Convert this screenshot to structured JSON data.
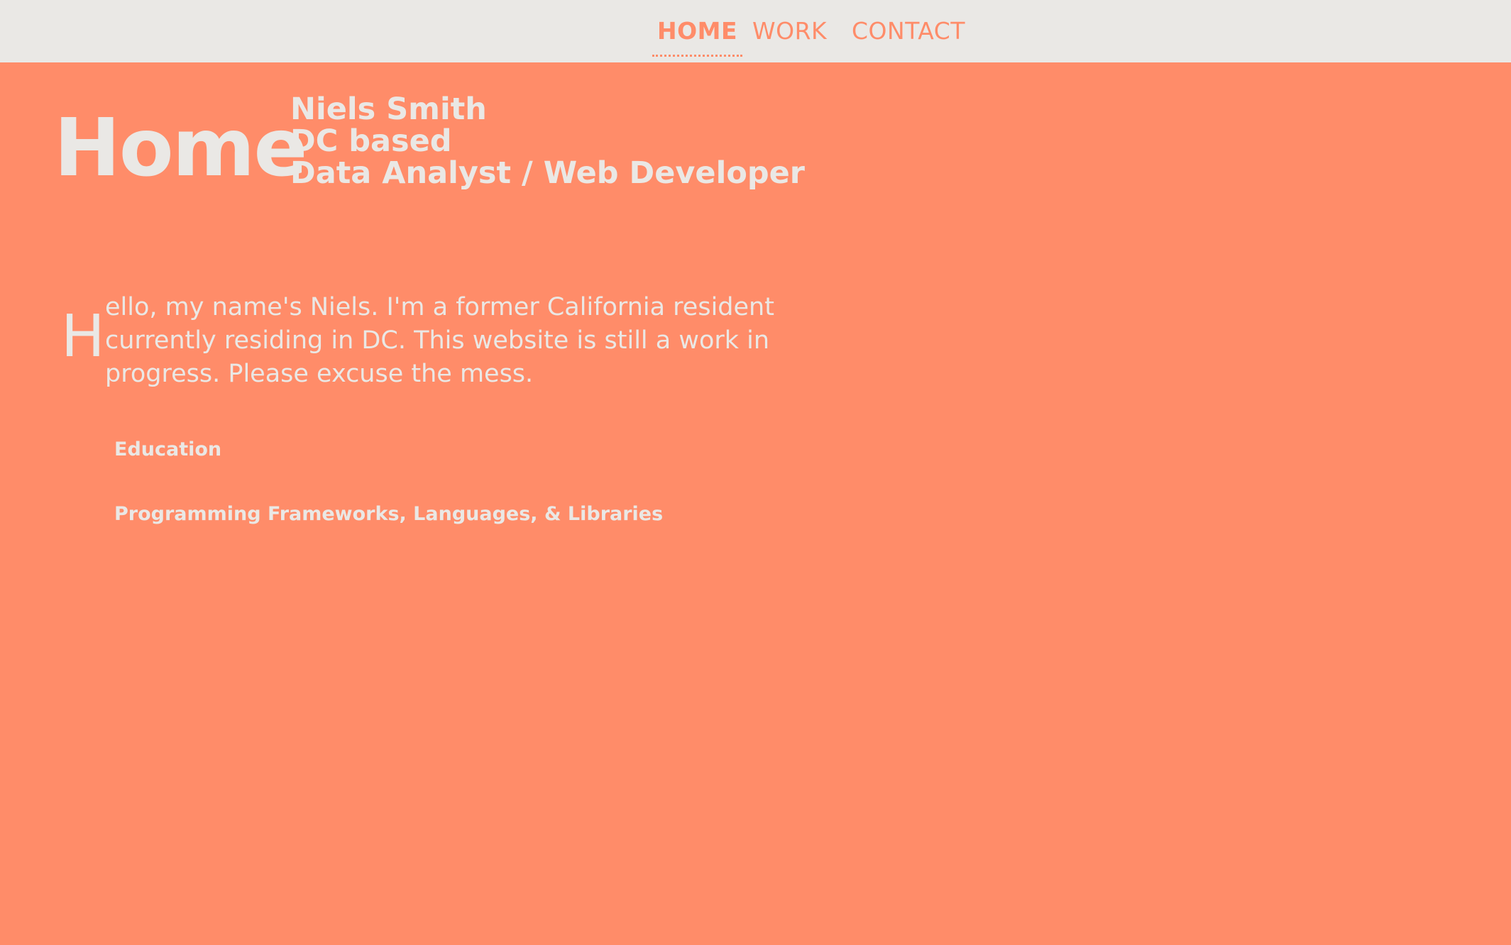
{
  "nav": {
    "items": [
      {
        "label": "HOME",
        "active": true
      },
      {
        "label": "WORK",
        "active": false
      },
      {
        "label": "CONTACT",
        "active": false
      }
    ]
  },
  "page": {
    "title": "Home",
    "identity": {
      "name": "Niels Smith",
      "location": "DC based",
      "role": "Data Analyst / Web Developer"
    },
    "intro": {
      "drop_cap": "H",
      "text": "ello, my name's Niels. I'm a former California resident currently residing in DC. This website is still a work in progress. Please excuse the mess."
    },
    "sections": [
      {
        "label": "Education"
      },
      {
        "label": "Programming Frameworks, Languages, & Libraries"
      }
    ]
  },
  "colors": {
    "background": "#ff8c69",
    "navbar": "#eae8e5",
    "text_light": "#eae8e5",
    "nav_text": "#ff8c69"
  }
}
